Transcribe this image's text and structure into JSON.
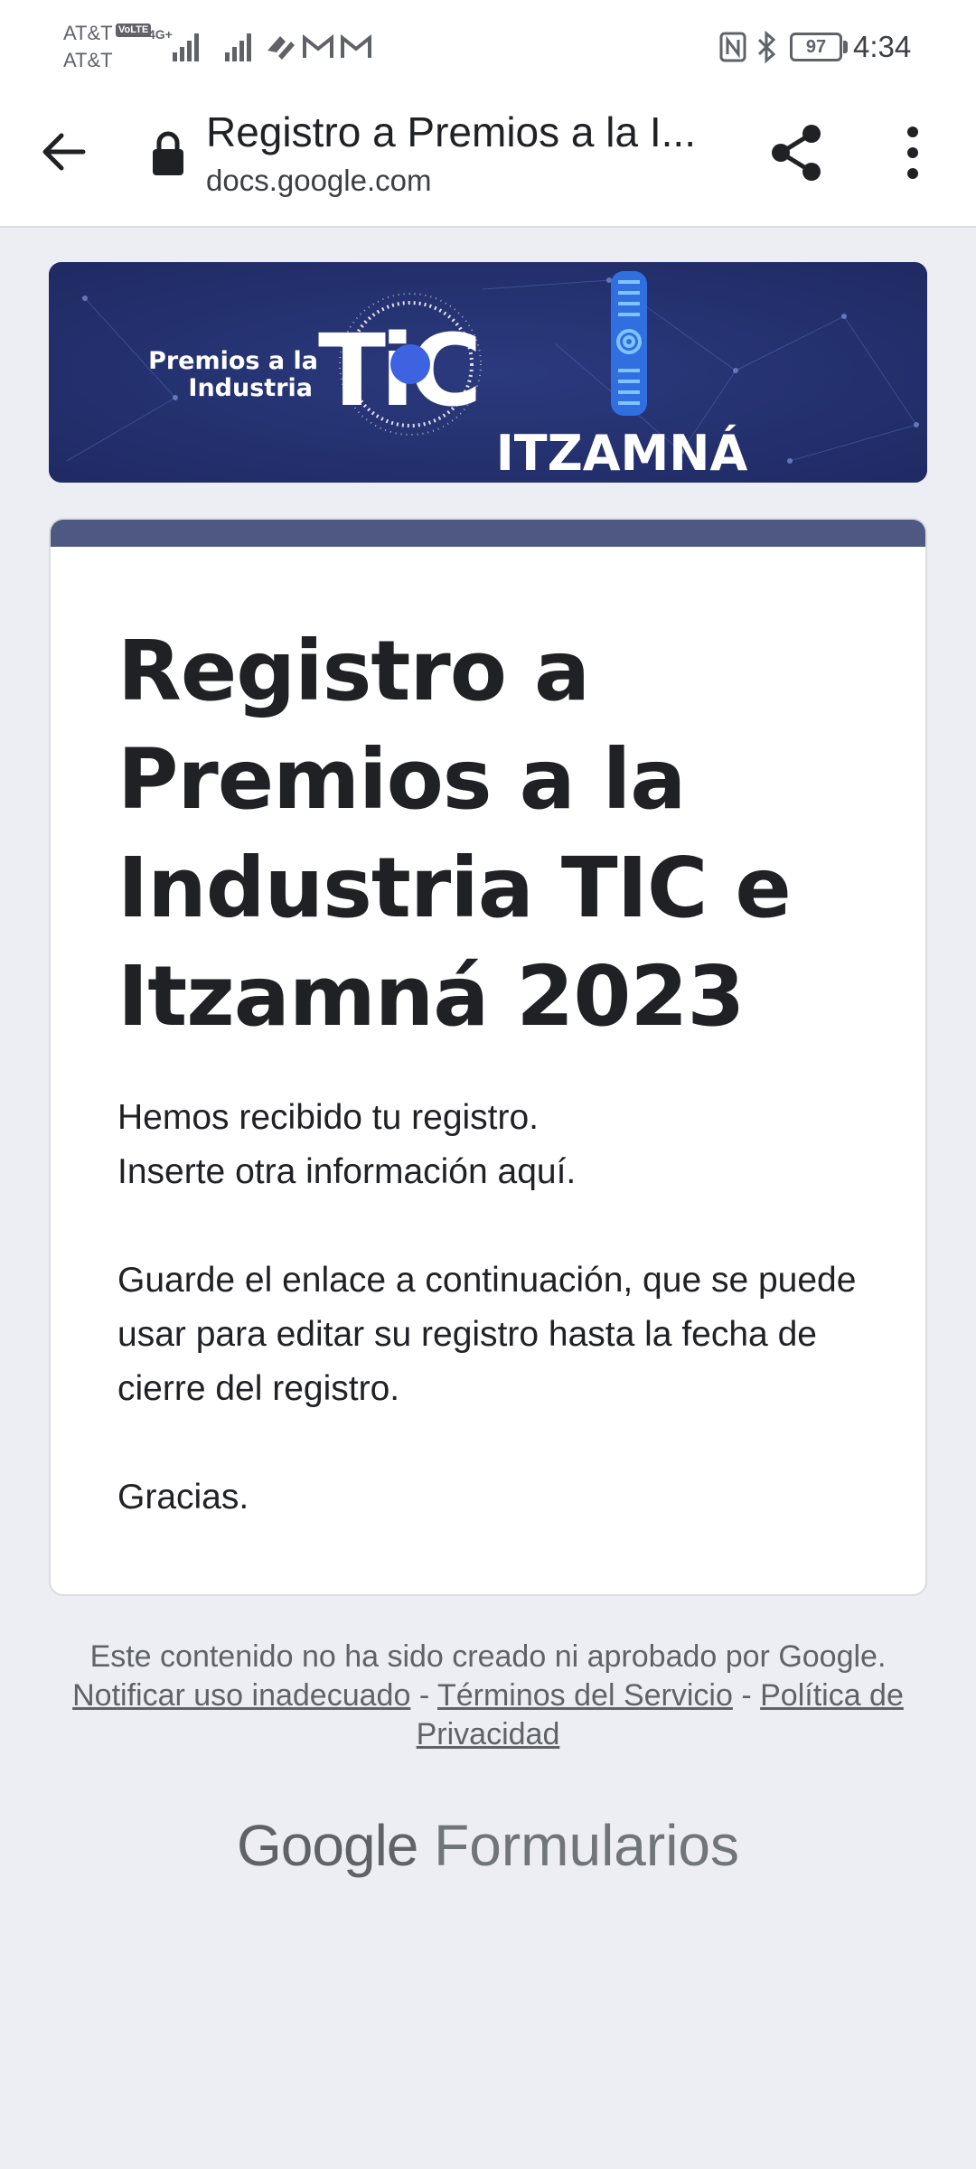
{
  "status_bar": {
    "carrier_1": "AT&T",
    "carrier_2": "AT&T",
    "volte": "VoLTE",
    "network": "4G+",
    "battery": "97",
    "time": "4:34"
  },
  "browser": {
    "page_title": "Registro a Premios a la I...",
    "url": "docs.google.com"
  },
  "banner": {
    "line_1": "Premios a la",
    "line_2": "Industria",
    "tic": "TiC",
    "itzamna": "ITZAMNÁ"
  },
  "form": {
    "title": "Registro a Premios a la Industria TIC e Itzamná 2023",
    "message_line_1": "Hemos recibido tu registro.",
    "message_line_2": "Inserte otra información aquí.",
    "message_para_2": "Guarde el enlace a continuación, que se puede usar para editar su registro hasta la fecha de cierre del registro.",
    "message_thanks": "Gracias."
  },
  "footer": {
    "disclaimer": "Este contenido no ha sido creado ni aprobado por Google.",
    "report_link": "Notificar uso inadecuado",
    "separator": "-",
    "terms_link": "Términos del Servicio",
    "privacy_link": "Política de Privacidad",
    "brand_google": "Google",
    "brand_product": "Formularios"
  },
  "colors": {
    "banner_bg": "#24306e",
    "card_accent": "#4f5882",
    "page_bg": "#eceef3"
  }
}
